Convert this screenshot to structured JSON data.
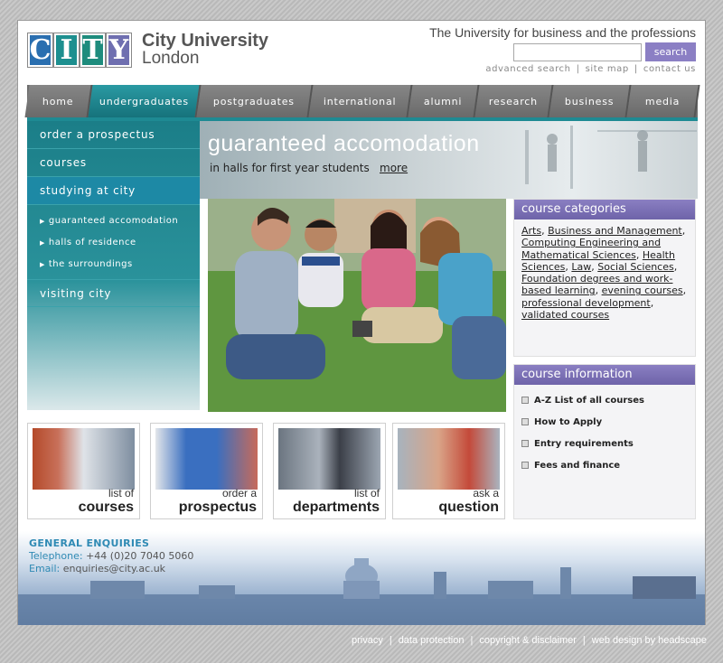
{
  "header": {
    "logo_letters": [
      "C",
      "I",
      "T",
      "Y"
    ],
    "logo_line1": "City University",
    "logo_line2": "London",
    "tagline": "The University for business and the professions",
    "search_button": "search",
    "search_placeholder": "",
    "utility_links": [
      "advanced search",
      "site map",
      "contact us"
    ]
  },
  "nav": {
    "items": [
      "home",
      "undergraduates",
      "postgraduates",
      "international",
      "alumni",
      "research",
      "business",
      "media"
    ],
    "active": "undergraduates"
  },
  "sidebar": {
    "items": [
      {
        "label": "order a prospectus"
      },
      {
        "label": "courses"
      },
      {
        "label": "studying at city"
      },
      {
        "label": "visiting city"
      }
    ],
    "subitems": [
      "guaranteed accomodation",
      "halls of residence",
      "the surroundings"
    ]
  },
  "hero": {
    "title": "guaranteed accomodation",
    "subtitle": "in halls for first year students",
    "more": "more"
  },
  "course_categories": {
    "heading": "course categories",
    "links": [
      "Arts",
      "Business and Management",
      "Computing Engineering and Mathematical Sciences",
      "Health Sciences",
      "Law",
      "Social Sciences",
      "Foundation degrees and work-based learning",
      "evening courses",
      "professional development",
      "validated courses"
    ]
  },
  "course_information": {
    "heading": "course information",
    "items": [
      "A-Z List of all courses",
      "How to Apply",
      "Entry requirements",
      "Fees and finance"
    ]
  },
  "thumbnails": [
    {
      "small": "list of",
      "big": "courses"
    },
    {
      "small": "order a",
      "big": "prospectus"
    },
    {
      "small": "list of",
      "big": "departments"
    },
    {
      "small": "ask a",
      "big": "question"
    }
  ],
  "contact": {
    "heading": "GENERAL ENQUIRIES",
    "telephone_label": "Telephone:",
    "telephone": "+44 (0)20 7040 5060",
    "email_label": "Email:",
    "email": "enquiries@city.ac.uk"
  },
  "footer": {
    "links": [
      "privacy",
      "data protection",
      "copyright & disclaimer",
      "web design by headscape"
    ]
  },
  "colors": {
    "accent_purple": "#8b7fc4",
    "teal": "#1b7e88",
    "nav_grey": "#6e6e6e",
    "contact_blue": "#2f8ab4"
  }
}
